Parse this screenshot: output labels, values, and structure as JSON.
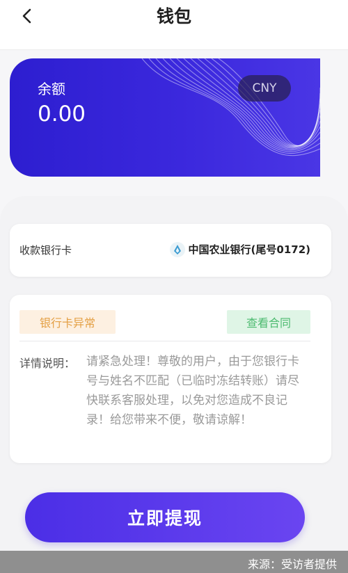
{
  "header": {
    "title": "钱包",
    "back_icon": "chevron-left-icon"
  },
  "balance": {
    "label": "余额",
    "value": "0.00",
    "currency": "CNY"
  },
  "bank": {
    "label": "收款银行卡",
    "name": "中国农业银行(尾号0172)",
    "logo_icon": "bank-logo-icon"
  },
  "detail": {
    "status_tag": "银行卡异常",
    "contract_button": "查看合同",
    "label": "详情说明：",
    "text": "请紧急处理！尊敬的用户，由于您银行卡号与姓名不匹配（已临时冻结转账）请尽快联系客服处理，以免对您造成不良记录！给您带来不便，敬请谅解！"
  },
  "action": {
    "withdraw_label": "立即提现"
  },
  "footer": {
    "source": "来源：受访者提供"
  },
  "colors": {
    "card_primary": "#2d1ed0",
    "warning": "#e4a045",
    "success": "#4dbb70",
    "button": "#5a3aeb"
  }
}
